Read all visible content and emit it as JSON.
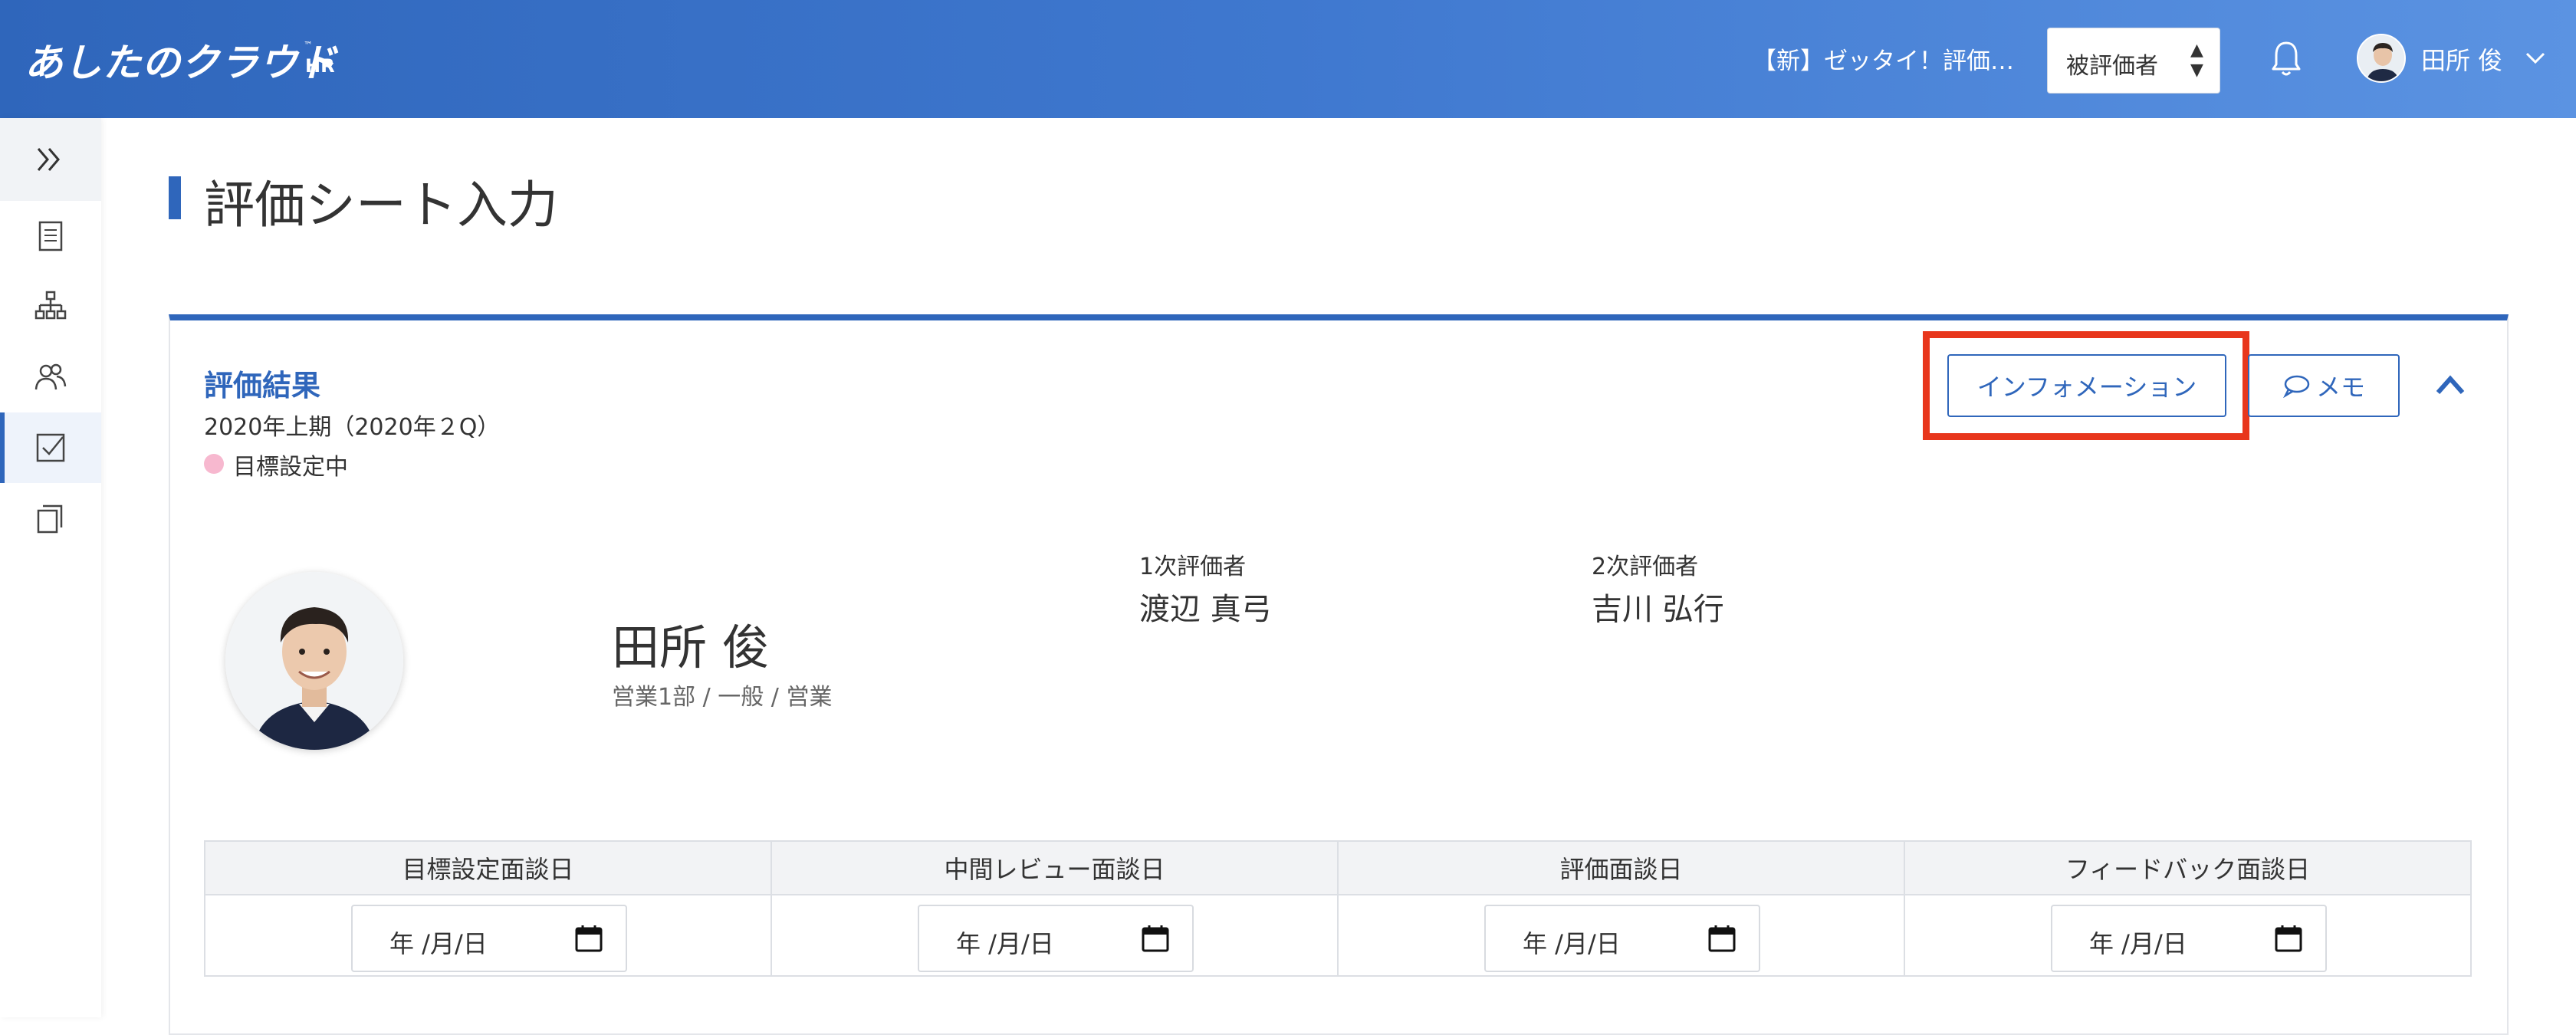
{
  "header": {
    "logo_text": "あしたのクラウド",
    "logo_sub": "HR",
    "logo_tm": "™",
    "sheet_title": "【新】ゼッタイ！評価…",
    "role_select": {
      "value": "被評価者",
      "arrow": "▲▼"
    },
    "user_name": "田所 俊"
  },
  "sidebar": {
    "items": [
      {
        "icon": "document-icon"
      },
      {
        "icon": "org-chart-icon"
      },
      {
        "icon": "users-icon"
      },
      {
        "icon": "checkbox-icon",
        "active": true
      },
      {
        "icon": "copy-icon"
      }
    ]
  },
  "page": {
    "title": "評価シート入力"
  },
  "card": {
    "section_title": "評価結果",
    "period": "2020年上期（2020年２Q）",
    "status": "目標設定中",
    "status_color": "#f7b8cf",
    "info_button": "インフォメーション",
    "memo_button": "メモ",
    "employee": {
      "name": "田所 俊",
      "dept": "営業1部 / 一般 / 営業"
    },
    "evaluators": [
      {
        "label": "1次評価者",
        "name": "渡辺 真弓"
      },
      {
        "label": "2次評価者",
        "name": "吉川 弘行"
      }
    ],
    "interview_dates": [
      {
        "label": "目標設定面談日",
        "placeholder": "年 /月/日"
      },
      {
        "label": "中間レビュー面談日",
        "placeholder": "年 /月/日"
      },
      {
        "label": "評価面談日",
        "placeholder": "年 /月/日"
      },
      {
        "label": "フィードバック面談日",
        "placeholder": "年 /月/日"
      }
    ]
  },
  "colors": {
    "accent": "#2f66bb",
    "highlight": "#e8361c"
  }
}
